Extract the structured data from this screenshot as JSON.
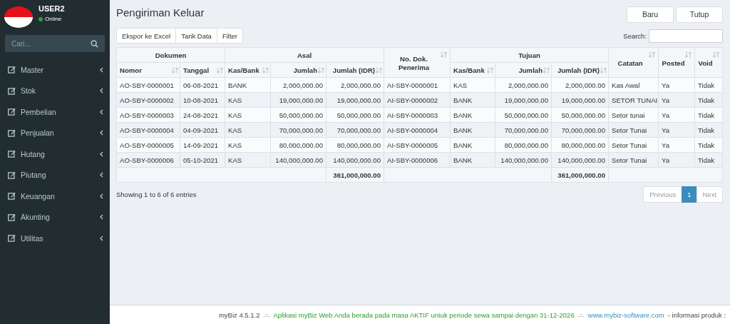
{
  "sidebar": {
    "user": {
      "name": "USER2",
      "status": "Online"
    },
    "search": {
      "placeholder": "Cari..."
    },
    "menu": [
      {
        "label": "Master"
      },
      {
        "label": "Stok"
      },
      {
        "label": "Pembelian"
      },
      {
        "label": "Penjualan"
      },
      {
        "label": "Hutang"
      },
      {
        "label": "Piutang"
      },
      {
        "label": "Keuangan"
      },
      {
        "label": "Akunting"
      },
      {
        "label": "Utilitas"
      }
    ]
  },
  "page": {
    "title": "Pengiriman Keluar",
    "header_buttons": [
      "Baru",
      "Tutup"
    ],
    "toolbar_buttons": [
      "Ekspor ke Excel",
      "Tarik Data",
      "Filter"
    ],
    "search_label": "Search:"
  },
  "table": {
    "header": [
      {
        "label": "Dokumen",
        "columns": [
          {
            "label": "Nomor",
            "sortable": true
          },
          {
            "label": "Tanggal",
            "sortable": true
          }
        ]
      },
      {
        "label": "Asal",
        "columns": [
          {
            "label": "Kas/Bank",
            "sortable": true
          },
          {
            "label": "Jumlah",
            "sortable": true
          },
          {
            "label": "Jumlah (IDR)",
            "sortable": true
          }
        ]
      },
      {
        "label": "No. Dok. Penerima",
        "sortable": true
      },
      {
        "label": "Tujuan",
        "columns": [
          {
            "label": "Kas/Bank",
            "sortable": true
          },
          {
            "label": "Jumlah",
            "sortable": true
          },
          {
            "label": "Jumlah (IDR)",
            "sortable": true
          }
        ]
      },
      {
        "label": "Catatan",
        "sortable": true
      },
      {
        "label": "Posted",
        "sortable": true
      },
      {
        "label": "Void",
        "sortable": true
      }
    ],
    "rows": [
      [
        "AO-SBY-0000001",
        "06-08-2021",
        "BANK",
        "2,000,000.00",
        "2,000,000.00",
        "AI-SBY-0000001",
        "KAS",
        "2,000,000.00",
        "2,000,000.00",
        "Kas Awal",
        "Ya",
        "Tidak"
      ],
      [
        "AO-SBY-0000002",
        "10-08-2021",
        "KAS",
        "19,000,000.00",
        "19,000,000.00",
        "AI-SBY-0000002",
        "BANK",
        "19,000,000.00",
        "19,000,000.00",
        "SETOR TUNAI",
        "Ya",
        "Tidak"
      ],
      [
        "AO-SBY-0000003",
        "24-08-2021",
        "KAS",
        "50,000,000.00",
        "50,000,000.00",
        "AI-SBY-0000003",
        "BANK",
        "50,000,000.00",
        "50,000,000.00",
        "Setor tunai",
        "Ya",
        "Tidak"
      ],
      [
        "AO-SBY-0000004",
        "04-09-2021",
        "KAS",
        "70,000,000.00",
        "70,000,000.00",
        "AI-SBY-0000004",
        "BANK",
        "70,000,000.00",
        "70,000,000.00",
        "Setor Tunai",
        "Ya",
        "Tidak"
      ],
      [
        "AO-SBY-0000005",
        "14-09-2021",
        "KAS",
        "80,000,000.00",
        "80,000,000.00",
        "AI-SBY-0000005",
        "BANK",
        "80,000,000.00",
        "80,000,000.00",
        "Setor Tunai",
        "Ya",
        "Tidak"
      ],
      [
        "AO-SBY-0000006",
        "05-10-2021",
        "KAS",
        "140,000,000.00",
        "140,000,000.00",
        "AI-SBY-0000006",
        "BANK",
        "140,000,000.00",
        "140,000,000.00",
        "Setor Tunai",
        "Ya",
        "Tidak"
      ]
    ],
    "totals": {
      "asal_idr": "361,000,000.00",
      "tujuan_idr": "361,000,000.00"
    },
    "info": "Showing 1 to 6 of 6 entries"
  },
  "pagination": [
    {
      "label": "Previous",
      "kind": "nav",
      "disabled": true,
      "selected": false
    },
    {
      "label": "1",
      "kind": "page",
      "disabled": false,
      "selected": true
    },
    {
      "label": "Next",
      "kind": "nav",
      "disabled": true,
      "selected": false
    }
  ],
  "footer": {
    "version": "myBiz 4.5.1.2",
    "separator_1": ".::.",
    "license": "Aplikasi myBiz Web Anda berada pada masa AKTIF untuk periode sewa sampai dengan 31-12-2026",
    "separator_2": ".::.",
    "link": "www.mybiz-software.com",
    "info": "- informasi produk :"
  }
}
